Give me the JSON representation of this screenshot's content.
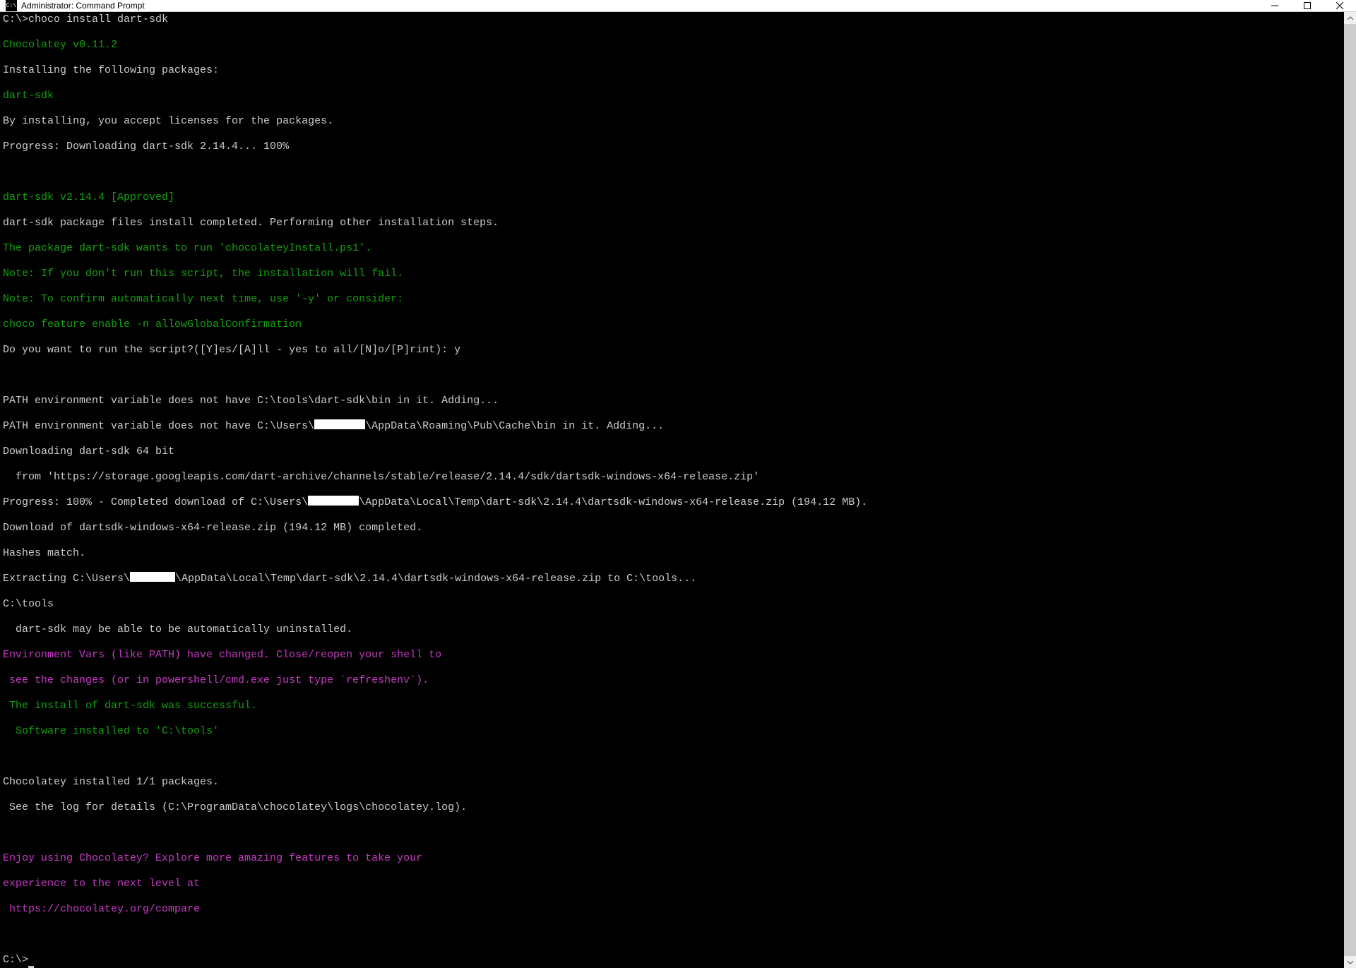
{
  "window": {
    "title": "Administrator: Command Prompt",
    "icon_label": "C:\\"
  },
  "term": {
    "l01": "C:\\>choco install dart-sdk",
    "l02": "Chocolatey v0.11.2",
    "l03": "Installing the following packages:",
    "l04": "dart-sdk",
    "l05": "By installing, you accept licenses for the packages.",
    "l06": "Progress: Downloading dart-sdk 2.14.4... 100%",
    "l07": "dart-sdk v2.14.4 [Approved]",
    "l08": "dart-sdk package files install completed. Performing other installation steps.",
    "l09": "The package dart-sdk wants to run 'chocolateyInstall.ps1'.",
    "l10": "Note: If you don't run this script, the installation will fail.",
    "l11": "Note: To confirm automatically next time, use '-y' or consider:",
    "l12": "choco feature enable -n allowGlobalConfirmation",
    "l13": "Do you want to run the script?([Y]es/[A]ll - yes to all/[N]o/[P]rint): y",
    "l14a": "PATH environment variable does not have C:\\tools\\dart-sdk\\bin in it. Adding...",
    "l15a": "PATH environment variable does not have C:\\Users\\",
    "l15b": "\\AppData\\Roaming\\Pub\\Cache\\bin in it. Adding...",
    "l16": "Downloading dart-sdk 64 bit",
    "l17": "  from 'https://storage.googleapis.com/dart-archive/channels/stable/release/2.14.4/sdk/dartsdk-windows-x64-release.zip'",
    "l18a": "Progress: 100% - Completed download of C:\\Users\\",
    "l18b": "\\AppData\\Local\\Temp\\dart-sdk\\2.14.4\\dartsdk-windows-x64-release.zip (194.12 MB).",
    "l19": "Download of dartsdk-windows-x64-release.zip (194.12 MB) completed.",
    "l20": "Hashes match.",
    "l21a": "Extracting C:\\Users\\",
    "l21b": "\\AppData\\Local\\Temp\\dart-sdk\\2.14.4\\dartsdk-windows-x64-release.zip to C:\\tools...",
    "l22": "C:\\tools",
    "l23": "  dart-sdk may be able to be automatically uninstalled.",
    "l24": "Environment Vars (like PATH) have changed. Close/reopen your shell to",
    "l25": " see the changes (or in powershell/cmd.exe just type `refreshenv`).",
    "l26": " The install of dart-sdk was successful.",
    "l27": "  Software installed to 'C:\\tools'",
    "l28": "Chocolatey installed 1/1 packages.",
    "l29": " See the log for details (C:\\ProgramData\\chocolatey\\logs\\chocolatey.log).",
    "l30": "Enjoy using Chocolatey? Explore more amazing features to take your",
    "l31": "experience to the next level at",
    "l32": " https://chocolatey.org/compare",
    "l33": "C:\\>"
  }
}
